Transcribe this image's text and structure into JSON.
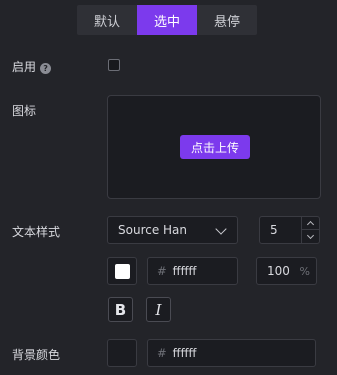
{
  "tabs": [
    {
      "label": "默认",
      "active": false
    },
    {
      "label": "选中",
      "active": true
    },
    {
      "label": "悬停",
      "active": false
    }
  ],
  "enable": {
    "label": "启用",
    "help_icon": "question-circle-icon",
    "checked": false
  },
  "icon": {
    "label": "图标",
    "upload_label": "点击上传"
  },
  "text_style": {
    "label": "文本样式",
    "font": "Source Han",
    "size": "5",
    "color_hash": "#",
    "color": "ffffff",
    "opacity": "100",
    "opacity_unit": "%",
    "bold": "B",
    "italic": "I"
  },
  "background": {
    "label": "背景颜色",
    "color_hash": "#",
    "color": "ffffff"
  },
  "colors": {
    "accent": "#7c3aed",
    "panel": "#232429",
    "input": "#1b1c21",
    "swatch": "#ffffff"
  }
}
